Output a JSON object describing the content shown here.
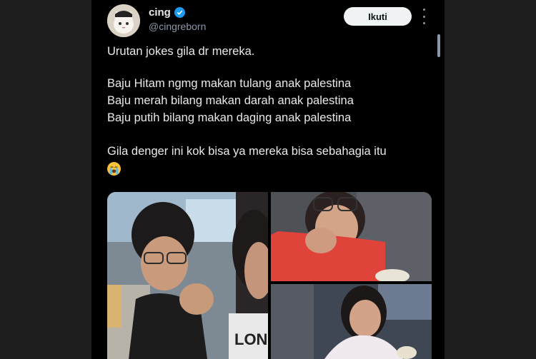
{
  "user": {
    "display_name": "cing",
    "handle": "@cingreborn"
  },
  "follow_button_label": "Ikuti",
  "tweet_lines": [
    "Urutan jokes gila dr mereka.",
    "Baju Hitam ngmg makan tulang anak palestina",
    "Baju merah bilang makan darah anak palestina",
    "Baju putih bilang makan daging anak palestina",
    "Gila denger ini kok bisa ya mereka bisa sebahagia itu"
  ],
  "emoji": "crying-face-emoji",
  "media_shirt_text": "LONE",
  "colors": {
    "background": "#000000",
    "text": "#e7e9ea",
    "handle": "#8b98a5",
    "verified": "#1d9bf0",
    "button_bg": "#eff3f4"
  }
}
